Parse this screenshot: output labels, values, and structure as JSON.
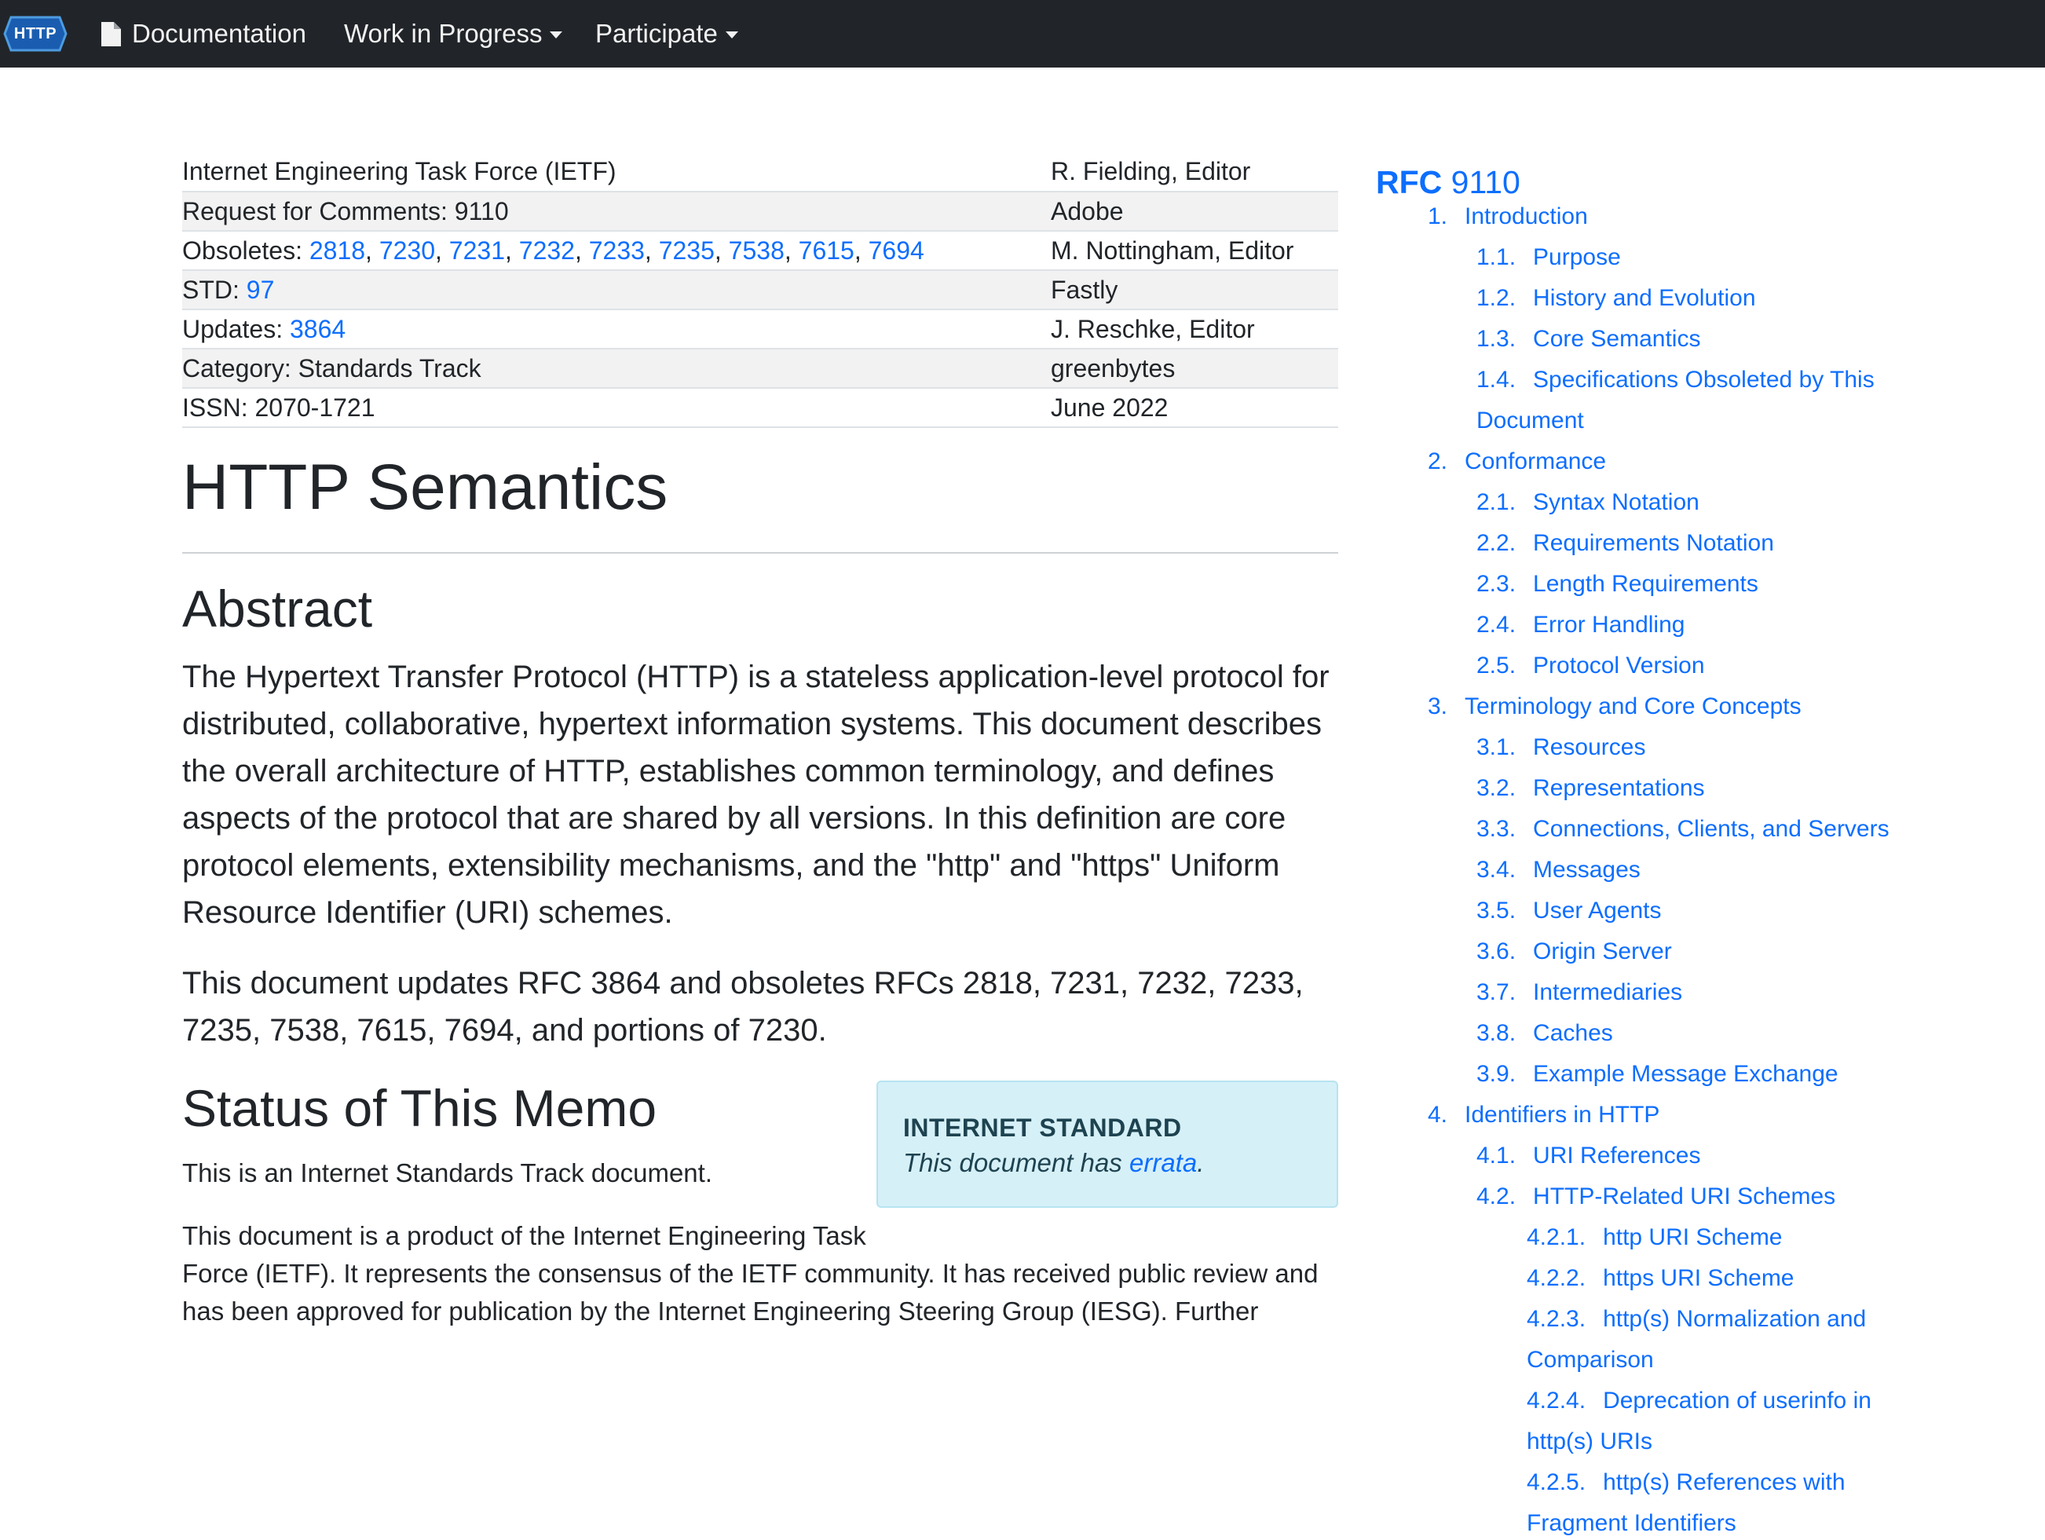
{
  "nav": {
    "brand": "HTTP",
    "documentation": "Documentation",
    "work_in_progress": "Work in Progress",
    "participate": "Participate"
  },
  "meta": {
    "org": "Internet Engineering Task Force (IETF)",
    "rfc_label": "Request for Comments: 9110",
    "obsoletes_label": "Obsoletes: ",
    "obsoletes": [
      "2818",
      "7230",
      "7231",
      "7232",
      "7233",
      "7235",
      "7538",
      "7615",
      "7694"
    ],
    "std_label": "STD: ",
    "std": "97",
    "updates_label": "Updates: ",
    "updates": "3864",
    "category": "Category: Standards Track",
    "issn": "ISSN: 2070-1721",
    "authors": [
      "R. Fielding, Editor",
      "Adobe",
      "M. Nottingham, Editor",
      "Fastly",
      "J. Reschke, Editor",
      "greenbytes",
      "June 2022"
    ]
  },
  "title": "HTTP Semantics",
  "abstract": {
    "heading": "Abstract",
    "p1": "The Hypertext Transfer Protocol (HTTP) is a stateless application-level protocol for distributed, collaborative, hypertext information systems. This document describes the overall architecture of HTTP, establishes common terminology, and defines aspects of the protocol that are shared by all versions. In this definition are core protocol elements, extensibility mechanisms, and the \"http\" and \"https\" Uniform Resource Identifier (URI) schemes.",
    "p2": "This document updates RFC 3864 and obsoletes RFCs 2818, 7231, 7232, 7233, 7235, 7538, 7615, 7694, and portions of 7230."
  },
  "status": {
    "heading": "Status of This Memo",
    "p1": "This is an Internet Standards Track document.",
    "p2_line1": "This document is a product of the Internet Engineering Task",
    "p2_line2": "Force (IETF). It represents the consensus of the IETF community. It has received public review and",
    "p2_line3": "has been approved for publication by the Internet Engineering Steering Group (IESG). Further"
  },
  "std_box": {
    "title": "INTERNET STANDARD",
    "text_before": "This document has ",
    "link": "errata",
    "text_after": "."
  },
  "toc": {
    "title_prefix": "RFC",
    "title_number": " 9110",
    "items": [
      {
        "num": "1.",
        "label": "Introduction"
      },
      {
        "num": "1.1.",
        "label": "Purpose"
      },
      {
        "num": "1.2.",
        "label": "History and Evolution"
      },
      {
        "num": "1.3.",
        "label": "Core Semantics"
      },
      {
        "num": "1.4.",
        "label": "Specifications Obsoleted by This"
      },
      {
        "num": "",
        "label": "Document"
      },
      {
        "num": "2.",
        "label": "Conformance"
      },
      {
        "num": "2.1.",
        "label": "Syntax Notation"
      },
      {
        "num": "2.2.",
        "label": "Requirements Notation"
      },
      {
        "num": "2.3.",
        "label": "Length Requirements"
      },
      {
        "num": "2.4.",
        "label": "Error Handling"
      },
      {
        "num": "2.5.",
        "label": "Protocol Version"
      },
      {
        "num": "3.",
        "label": "Terminology and Core Concepts"
      },
      {
        "num": "3.1.",
        "label": "Resources"
      },
      {
        "num": "3.2.",
        "label": "Representations"
      },
      {
        "num": "3.3.",
        "label": "Connections, Clients, and Servers"
      },
      {
        "num": "3.4.",
        "label": "Messages"
      },
      {
        "num": "3.5.",
        "label": "User Agents"
      },
      {
        "num": "3.6.",
        "label": "Origin Server"
      },
      {
        "num": "3.7.",
        "label": "Intermediaries"
      },
      {
        "num": "3.8.",
        "label": "Caches"
      },
      {
        "num": "3.9.",
        "label": "Example Message Exchange"
      },
      {
        "num": "4.",
        "label": "Identifiers in HTTP"
      },
      {
        "num": "4.1.",
        "label": "URI References"
      },
      {
        "num": "4.2.",
        "label": "HTTP-Related URI Schemes"
      },
      {
        "num": "4.2.1.",
        "label": "http URI Scheme"
      },
      {
        "num": "4.2.2.",
        "label": "https URI Scheme"
      },
      {
        "num": "4.2.3.",
        "label": "http(s) Normalization and"
      },
      {
        "num": "",
        "label": "Comparison"
      },
      {
        "num": "4.2.4.",
        "label": "Deprecation of userinfo in"
      },
      {
        "num": "",
        "label": "http(s) URIs"
      },
      {
        "num": "4.2.5.",
        "label": "http(s) References with"
      },
      {
        "num": "",
        "label": "Fragment Identifiers"
      }
    ]
  },
  "colors": {
    "navbar": "#212529",
    "link": "#0d6efd",
    "alert_bg": "#d6f0f8"
  }
}
